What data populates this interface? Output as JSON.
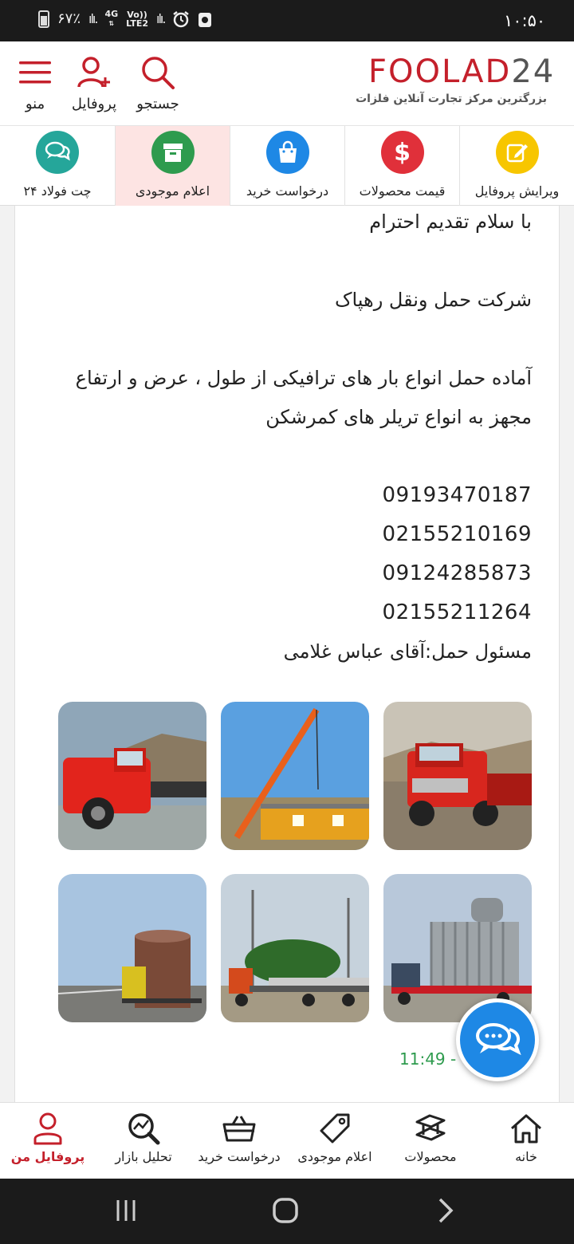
{
  "status_bar": {
    "time": "۱۰:۵۰",
    "battery": "۶۷٪",
    "network_top": "4G",
    "network_bottom": "LTE2",
    "volte": "Vo))"
  },
  "header": {
    "logo_main": "FOOLAD",
    "logo_num": "24",
    "logo_tagline": "بزرگترین مرکز تجارت آنلاین فلزات",
    "search_label": "جستجو",
    "profile_label": "پروفایل",
    "menu_label": "منو"
  },
  "quick_actions": [
    {
      "label": "ویرایش پروفایل",
      "color": "#f7c600",
      "icon": "edit-icon"
    },
    {
      "label": "قیمت محصولات",
      "color": "#e0303a",
      "icon": "dollar-icon"
    },
    {
      "label": "درخواست خرید",
      "color": "#1e88e5",
      "icon": "shopping-bag-icon"
    },
    {
      "label": "اعلام موجودی",
      "color": "#2e9b4e",
      "icon": "archive-box-icon"
    },
    {
      "label": "چت فولاد ۲۴",
      "color": "#25a69a",
      "icon": "chat-icon"
    }
  ],
  "post": {
    "greeting": "با سلام تقدیم احترام",
    "company": "شرکت حمل ونقل رهپاک",
    "desc_line1": "آماده حمل انواع بار های ترافیکی از طول ، عرض و ارتفاع",
    "desc_line2": "مجهز به انواع تریلر های کمرشکن",
    "phones": [
      "09193470187",
      "02155210169",
      "09124285873",
      "02155211264"
    ],
    "contact": "مسئول حمل:آقای عباس غلامی",
    "timestamp": "11:49 - 03/"
  },
  "photos": [
    {
      "subject": "red-truck-on-road"
    },
    {
      "subject": "crane-lifting-container"
    },
    {
      "subject": "red-truck-on-wet-road"
    },
    {
      "subject": "transformer-on-lowbed-trailer"
    },
    {
      "subject": "flatbed-trailer-with-trees"
    },
    {
      "subject": "steel-coil-on-truck-highway"
    }
  ],
  "bottom_nav": [
    {
      "label": "خانه",
      "icon": "home-icon"
    },
    {
      "label": "محصولات",
      "icon": "steel-beam-icon"
    },
    {
      "label": "اعلام موجودی",
      "icon": "tag-icon"
    },
    {
      "label": "درخواست خرید",
      "icon": "basket-icon"
    },
    {
      "label": "تحلیل بازار",
      "icon": "market-analysis-icon"
    },
    {
      "label": "پروفایل من",
      "icon": "user-icon"
    }
  ],
  "colors": {
    "brand_red": "#c4202b",
    "timestamp_green": "#2e9b4e",
    "fab_blue": "#1e88e5"
  }
}
